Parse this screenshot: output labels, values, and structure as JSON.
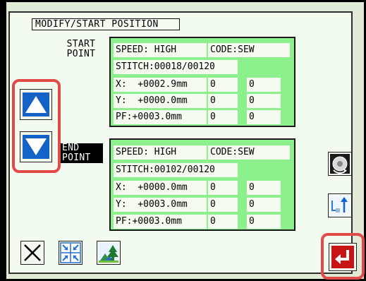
{
  "screen": {
    "title": "MODIFY/START POSITION"
  },
  "start_point": {
    "label_line1": "START",
    "label_line2": "POINT",
    "speed": "SPEED: HIGH",
    "code": "CODE:SEW",
    "stitch": "STITCH:00018/00120",
    "x_value": "X:  +0002.9mm",
    "x_col1": "0",
    "x_col2": "0",
    "y_value": "Y:  +0000.0mm",
    "y_col1": "0",
    "y_col2": "0",
    "pf_value": "PF:+0003.0mm",
    "pf_col1": "0",
    "pf_col2": "0"
  },
  "end_point": {
    "label_line1": "END",
    "label_line2": "POINT",
    "speed": "SPEED: HIGH",
    "code": "CODE:SEW",
    "stitch": "STITCH:00102/00120",
    "x_value": "X:  +0000.0mm",
    "x_col1": "0",
    "x_col2": "0",
    "y_value": "Y:  +0003.0mm",
    "y_col1": "0",
    "y_col2": "0",
    "pf_value": "PF:+0003.0mm",
    "pf_col1": "0",
    "pf_col2": "0"
  },
  "buttons": {
    "up": "triangle-up-icon",
    "down": "triangle-down-icon",
    "cancel": "x-close-icon",
    "expand": "expand-arrows-icon",
    "scene": "scenery-icon",
    "wheel": "handwheel-icon",
    "swap": "swap-position-icon",
    "enter": "enter-return-icon"
  },
  "colors": {
    "panel_green": "#8cf08c",
    "field_bg": "#f6fbf2",
    "highlight_red": "#e24a4a",
    "arrow_blue": "#1462c8",
    "enter_red": "#c81414"
  }
}
